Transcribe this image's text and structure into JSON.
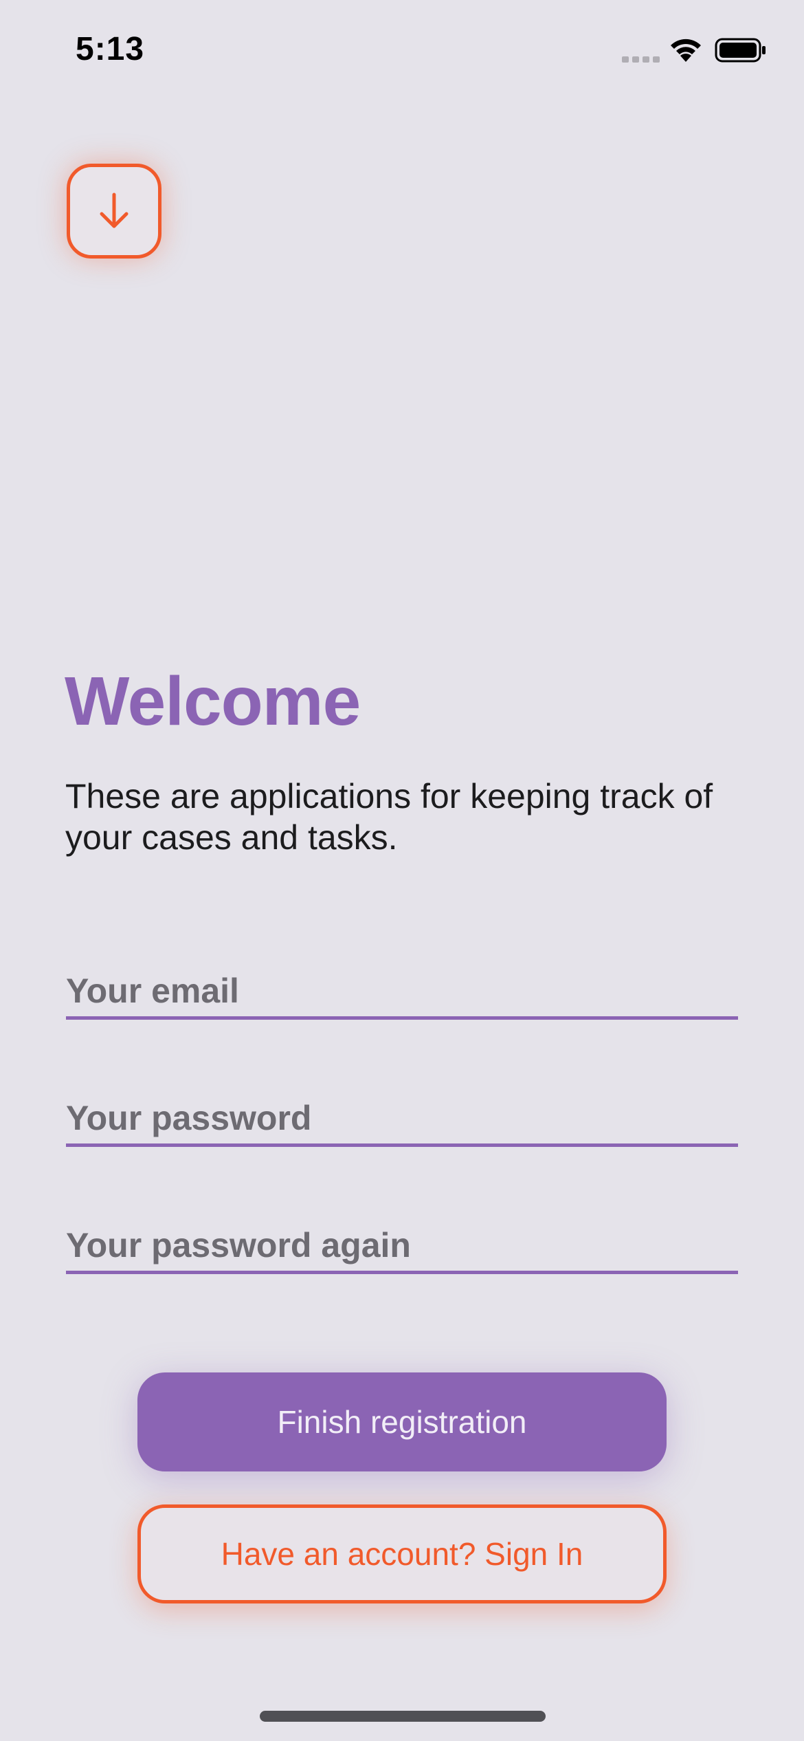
{
  "status_bar": {
    "time": "5:13"
  },
  "header": {
    "download_icon": "arrow-down-icon"
  },
  "main": {
    "title": "Welcome",
    "subtitle": "These are applications for keeping track of your cases and tasks."
  },
  "form": {
    "email_placeholder": "Your email",
    "email_value": "",
    "password_placeholder": "Your password",
    "password_value": "",
    "password_again_placeholder": "Your password again",
    "password_again_value": ""
  },
  "actions": {
    "finish_label": "Finish registration",
    "sign_in_label": "Have an account? Sign In"
  },
  "colors": {
    "accent_purple": "#8b64b4",
    "accent_orange": "#f15a2b",
    "background": "#e5e3ea"
  }
}
